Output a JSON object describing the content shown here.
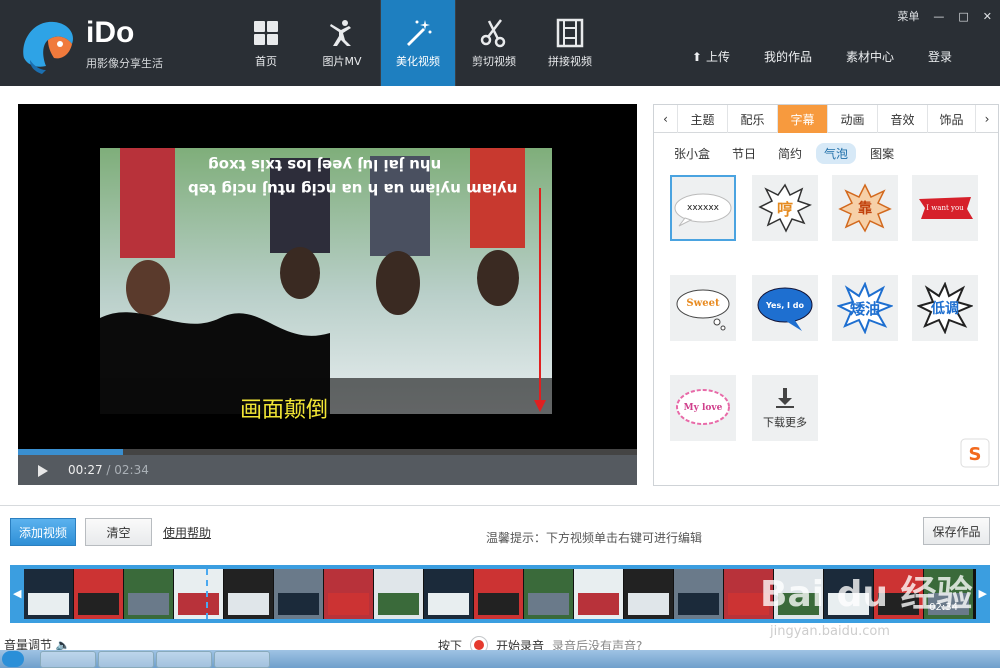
{
  "app": {
    "brand": "iDo",
    "slogan": "用影像分享生活",
    "menu_label": "菜单"
  },
  "nav": [
    {
      "label": "首页",
      "icon": "grid-icon"
    },
    {
      "label": "图片MV",
      "icon": "dancer-icon"
    },
    {
      "label": "美化视频",
      "icon": "magic-wand-icon",
      "active": true
    },
    {
      "label": "剪切视频",
      "icon": "scissors-icon"
    },
    {
      "label": "拼接视频",
      "icon": "film-strip-icon"
    }
  ],
  "top_links": {
    "upload": "上传",
    "my_works": "我的作品",
    "material_center": "素材中心",
    "login": "登录"
  },
  "player": {
    "current_time": "00:27",
    "total_time": "/ 02:34",
    "progress": 0.17,
    "overlay_caption": "画面颠倒",
    "mirrored_line1": "nhu jai luj yeej los txis txog",
    "mirrored_line2": "nyiam nyiam ua h ua ncig ntuj ncig teb"
  },
  "panel": {
    "tabs": [
      "主题",
      "配乐",
      "字幕",
      "动画",
      "音效",
      "饰品"
    ],
    "active_tab": "字幕",
    "subtabs": [
      "张小盒",
      "节日",
      "简约",
      "气泡",
      "图案"
    ],
    "active_subtab": "气泡",
    "stickers": [
      {
        "name": "cloud-bubble",
        "text": "xxxxxx"
      },
      {
        "name": "burst-bubble",
        "text": "哼"
      },
      {
        "name": "explosion-bubble",
        "text": "靠"
      },
      {
        "name": "red-ribbon-bubble",
        "text": "I want you"
      },
      {
        "name": "sweet-bubble",
        "text": "Sweet"
      },
      {
        "name": "blue-cloud-bubble",
        "text": "Yes, I do"
      },
      {
        "name": "spiky-star-bubble",
        "text": "矮油"
      },
      {
        "name": "spiky-dark-bubble",
        "text": "低调"
      },
      {
        "name": "pink-cloud-bubble",
        "text": "My love"
      }
    ],
    "download_more": "下载更多"
  },
  "toolbar": {
    "add_video": "添加视频",
    "clear": "清空",
    "help": "使用帮助",
    "tip": "温馨提示：下方视频单击右键可进行编辑",
    "save": "保存作品"
  },
  "timeline": {
    "duration": "02:34"
  },
  "audio": {
    "volume_label": "音量调节",
    "press_label": "按下",
    "start_record": "开始录音",
    "no_sound_question": "录音后没有声音?"
  },
  "watermark": {
    "main": "Bai du 经验",
    "sub": "jingyan.baidu.com"
  },
  "colors": {
    "header_bg": "#2a2f35",
    "accent_blue": "#1e7fc0",
    "tab_orange": "#f79a3e",
    "timeline_blue": "#3b9ee0"
  }
}
